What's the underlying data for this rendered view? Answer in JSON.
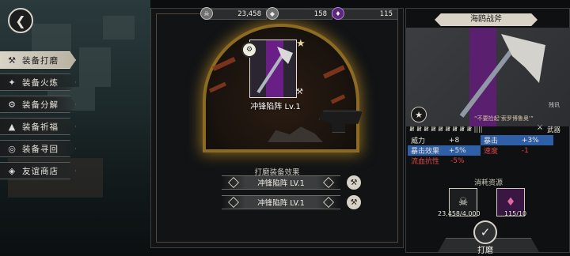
{
  "nav": {
    "back_icon": "back-arrow-icon",
    "items": [
      {
        "label": "装备打磨",
        "icon": "hammer-icon",
        "active": true
      },
      {
        "label": "装备火炼",
        "icon": "flame-icon",
        "active": false
      },
      {
        "label": "装备分解",
        "icon": "disassemble-icon",
        "active": false
      },
      {
        "label": "装备祈福",
        "icon": "prayer-icon",
        "active": false
      },
      {
        "label": "装备寻回",
        "icon": "retrieve-icon",
        "active": false
      },
      {
        "label": "友谊商店",
        "icon": "fox-icon",
        "active": false
      }
    ]
  },
  "currency": {
    "silver": "23,458",
    "ore": "158",
    "crystal": "115"
  },
  "forge": {
    "item_name": "冲锋陷阵 Lv.1",
    "effect_title": "打磨装备效果",
    "effects": [
      "冲锋陷阵 LV.1",
      "冲锋陷阵 LV.1"
    ]
  },
  "weapon": {
    "title": "海鸥战斧",
    "quote": "“不要捡起‘索罗博鲁奥’”",
    "break_label": "残讯",
    "tally": "𝍸 𝍸 𝍸 𝍸 𝍸 𝍸 𝍸 𝍸 𝍸 ||||",
    "type_label": "武器",
    "stats": [
      {
        "label": "威力",
        "value": "+8",
        "label2": "暴击",
        "value2": "+3%"
      },
      {
        "label": "暴击效果",
        "value": "+5%",
        "label2": "速度",
        "value2": "-1"
      },
      {
        "label": "流血抗性",
        "value": "-5%",
        "label2": "",
        "value2": ""
      }
    ],
    "cost_title": "消耗资源",
    "cost": [
      {
        "value": "23,458/4,000",
        "icon": "silver-coin-icon"
      },
      {
        "value": "115/10",
        "icon": "crystal-icon"
      }
    ],
    "polish_label": "打磨"
  },
  "colors": {
    "accent_gold": "#e0a82a",
    "stat_blue": "#2f5fa6",
    "stat_red": "#e04848",
    "purple": "#5b1f70"
  }
}
